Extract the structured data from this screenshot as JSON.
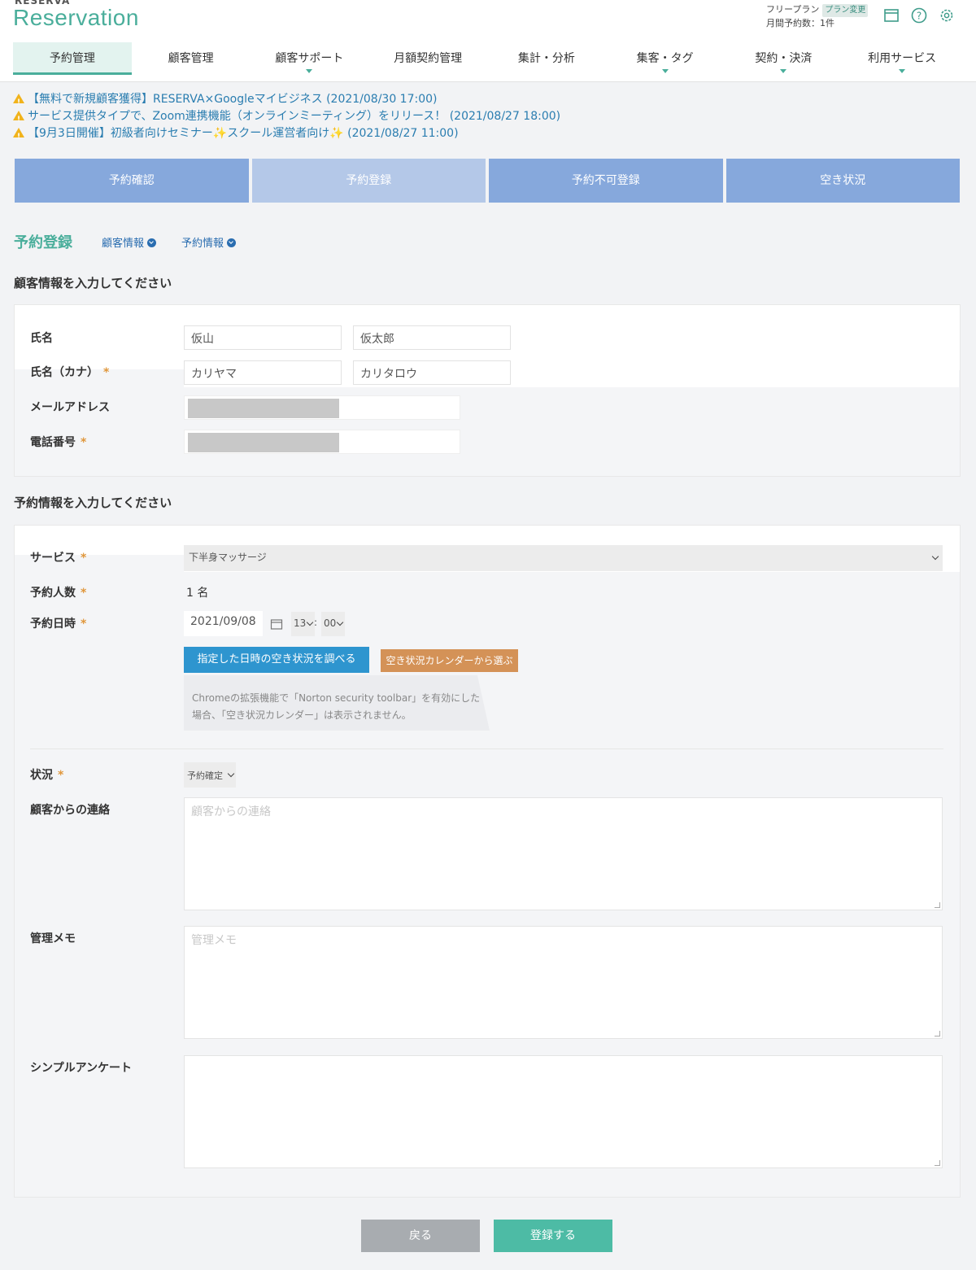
{
  "header": {
    "brand_small": "RESERVA",
    "brand": "Reservation",
    "plan_label": "フリープラン",
    "plan_change": "プラン変更",
    "monthly": "月間予約数：1件"
  },
  "nav": [
    {
      "label": "予約管理"
    },
    {
      "label": "顧客管理"
    },
    {
      "label": "顧客サポート"
    },
    {
      "label": "月額契約管理"
    },
    {
      "label": "集計・分析"
    },
    {
      "label": "集客・タグ"
    },
    {
      "label": "契約・決済"
    },
    {
      "label": "利用サービス"
    }
  ],
  "notices": [
    "【無料で新規顧客獲得】RESERVA×Googleマイビジネス (2021/08/30 17:00)",
    "サービス提供タイプで、Zoom連携機能（オンラインミーティング）をリリース！ (2021/08/27 18:00)",
    "【9月3日開催】初級者向けセミナー✨スクール運営者向け✨ (2021/08/27 11:00)"
  ],
  "tabs": [
    "予約確認",
    "予約登録",
    "予約不可登録",
    "空き状況"
  ],
  "page": {
    "title": "予約登録",
    "anchor_customer": "顧客情報",
    "anchor_reservation": "予約情報"
  },
  "customer": {
    "heading": "顧客情報を入力してください",
    "name_label": "氏名",
    "last_name": "仮山",
    "first_name": "仮太郎",
    "kana_label": "氏名（カナ）",
    "last_kana": "カリヤマ",
    "first_kana": "カリタロウ",
    "email_label": "メールアドレス",
    "phone_label": "電話番号",
    "required_mark": "*"
  },
  "reservation": {
    "heading": "予約情報を入力してください",
    "service_label": "サービス",
    "service_value": "下半身マッサージ",
    "people_label": "予約人数",
    "people_value": "1 名",
    "datetime_label": "予約日時",
    "date_value": "2021/09/08",
    "hour_value": "13",
    "time_sep": ":",
    "minute_value": "00",
    "check_button": "指定した日時の空き状況を調べる",
    "calendar_button": "空き状況カレンダーから選ぶ",
    "note_line1": "Chromeの拡張機能で「Norton security toolbar」を有効にした",
    "note_line2": "場合、「空き状況カレンダー」は表示されません。",
    "status_label": "状況",
    "status_value": "予約確定",
    "contact_label": "顧客からの連絡",
    "contact_placeholder": "顧客からの連絡",
    "memo_label": "管理メモ",
    "memo_placeholder": "管理メモ",
    "survey_label": "シンプルアンケート"
  },
  "footer": {
    "back": "戻る",
    "submit": "登録する"
  },
  "colors": {
    "accent": "#4aae9b",
    "tab": "#86a8dc",
    "tab_current": "#b4c8e8",
    "link": "#2a7db0",
    "back_button": "#a8acb0",
    "submit_button": "#4dbba5"
  }
}
